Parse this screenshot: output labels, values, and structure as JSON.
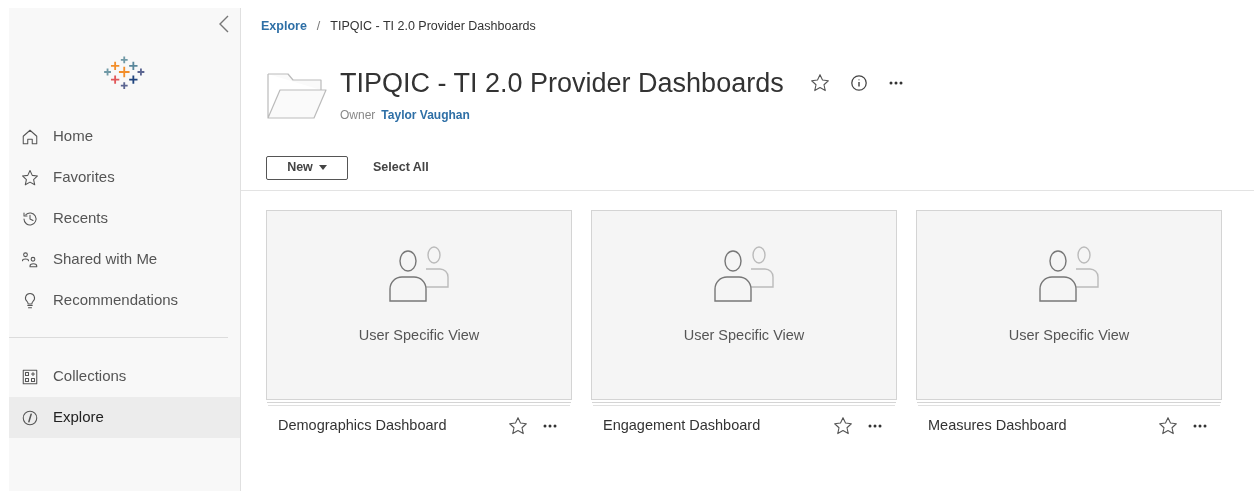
{
  "sidebar": {
    "groups": [
      {
        "items": [
          {
            "label": "Home",
            "selected": false
          },
          {
            "label": "Favorites",
            "selected": false
          },
          {
            "label": "Recents",
            "selected": false
          },
          {
            "label": "Shared with Me",
            "selected": false
          },
          {
            "label": "Recommendations",
            "selected": false
          }
        ]
      },
      {
        "items": [
          {
            "label": "Collections",
            "selected": false
          },
          {
            "label": "Explore",
            "selected": true
          }
        ]
      }
    ]
  },
  "breadcrumb": [
    {
      "label": "Explore",
      "kind": "link"
    },
    {
      "label": "/",
      "kind": "separator"
    },
    {
      "label": "TIPQIC - TI 2.0 Provider Dashboards",
      "kind": "current"
    }
  ],
  "project": {
    "title": "TIPQIC - TI 2.0 Provider Dashboards",
    "owner_label": "Owner",
    "owner": "Taylor Vaughan"
  },
  "toolbar": {
    "new_button": "New",
    "select_all": "Select All"
  },
  "cards": [
    {
      "thumbnail_text": "User Specific View",
      "title": "Demographics Dashboard",
      "favorite": false
    },
    {
      "thumbnail_text": "User Specific View",
      "title": "Engagement Dashboard",
      "favorite": false
    },
    {
      "thumbnail_text": "User Specific View",
      "title": "Measures Dashboard",
      "favorite": false
    }
  ]
}
